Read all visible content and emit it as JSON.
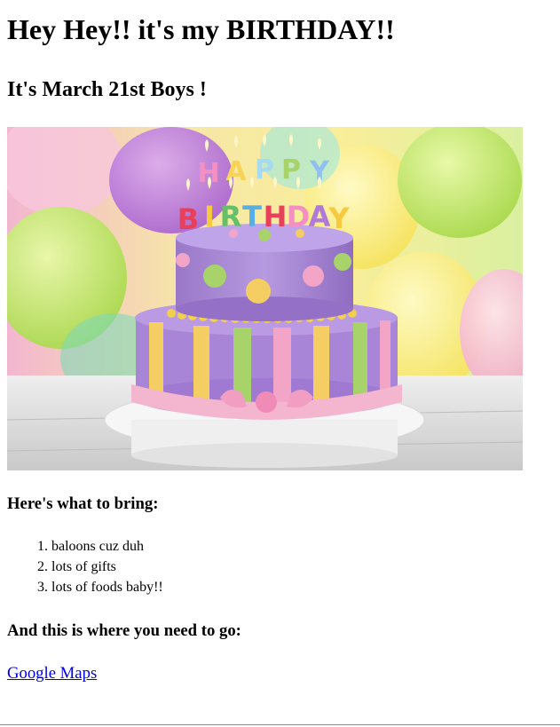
{
  "header": {
    "title": "Hey Hey!! it's my BIRTHDAY!!",
    "subtitle": "It's March 21st Boys !"
  },
  "image": {
    "description_icon": "birthday-cake-photo",
    "candle_text_top": "HAPPY",
    "candle_text_bottom": "BIRTHDAY"
  },
  "bring": {
    "heading": "Here's what to bring:",
    "items": [
      "baloons cuz duh",
      "lots of gifts",
      "lots of foods baby!!"
    ]
  },
  "location": {
    "heading": "And this is where you need to go:",
    "link_text": "Google Maps"
  },
  "colors": {
    "link": "#0000ee",
    "text": "#000000"
  }
}
